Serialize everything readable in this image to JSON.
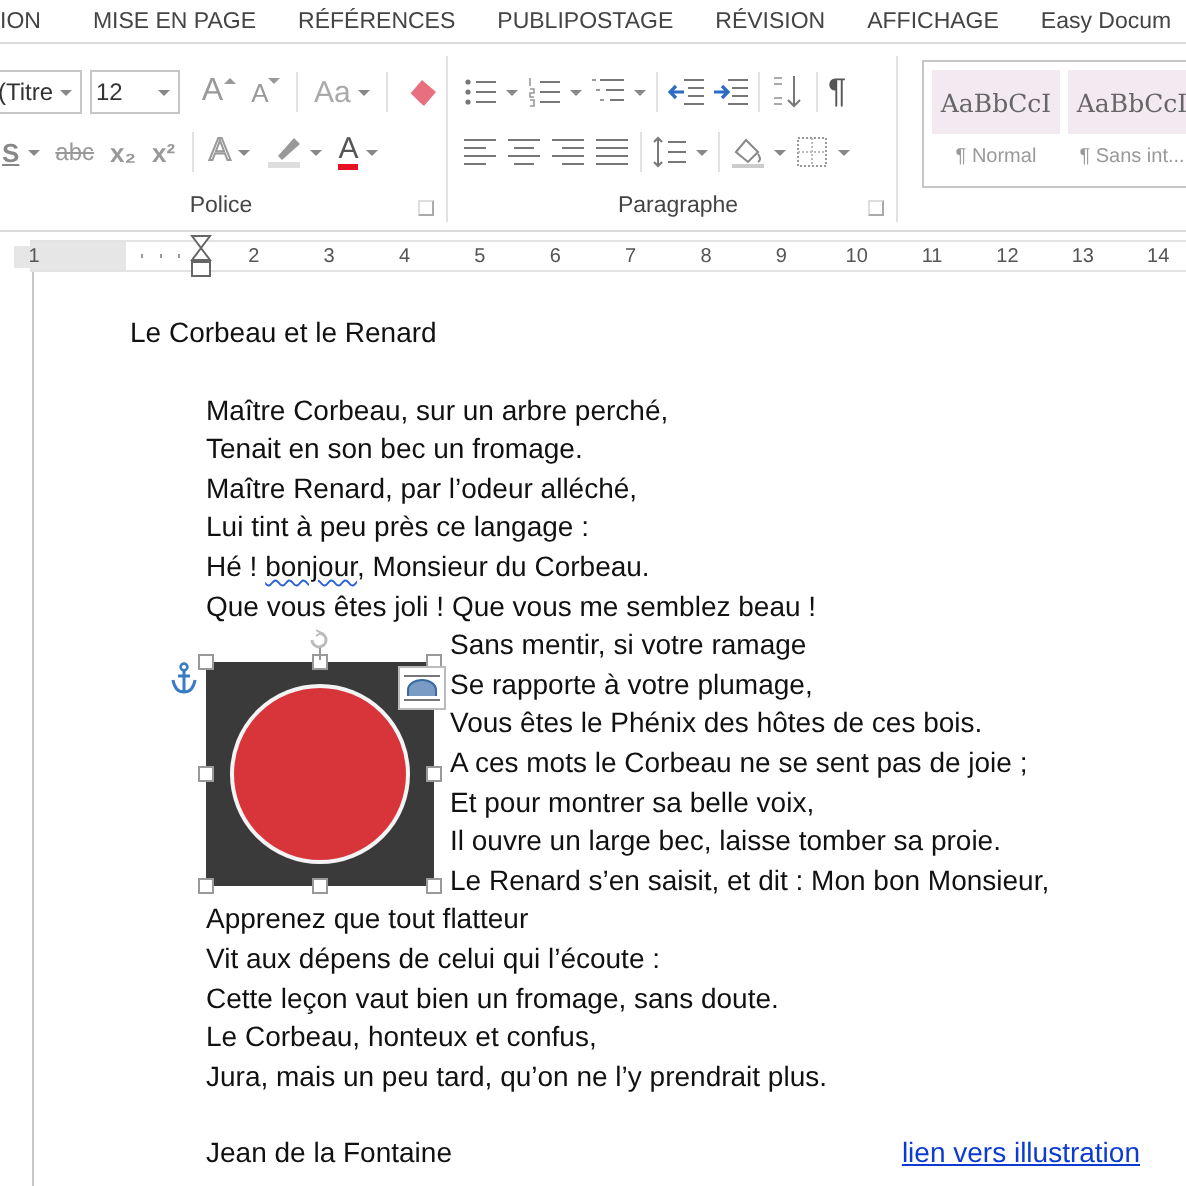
{
  "tabs": [
    {
      "label": "ION"
    },
    {
      "label": "MISE EN PAGE"
    },
    {
      "label": "RÉFÉRENCES"
    },
    {
      "label": "PUBLIPOSTAGE"
    },
    {
      "label": "RÉVISION"
    },
    {
      "label": "AFFICHAGE"
    },
    {
      "label": "Easy Docum"
    }
  ],
  "font_group": {
    "font_name": "(Titre",
    "font_size": "12",
    "label": "Police",
    "row1": [
      {
        "kind": "grow",
        "label": "A"
      },
      {
        "kind": "shrink",
        "label": "A"
      },
      {
        "kind": "sep"
      },
      {
        "kind": "case",
        "label": "Aa",
        "dropdown": true
      },
      {
        "kind": "sep"
      },
      {
        "kind": "eraser"
      }
    ],
    "row2": [
      {
        "kind": "underline",
        "label": "S",
        "dropdown": true
      },
      {
        "kind": "strike",
        "label": "abc"
      },
      {
        "kind": "subscript",
        "label": "x₂"
      },
      {
        "kind": "superscript",
        "label": "x²"
      },
      {
        "kind": "sep"
      },
      {
        "kind": "effects",
        "label": "A",
        "dropdown": true
      },
      {
        "kind": "highlight",
        "dropdown": true
      },
      {
        "kind": "fontcolor",
        "label": "A",
        "dropdown": true
      }
    ]
  },
  "paragraph_group": {
    "label": "Paragraphe",
    "row1": [
      {
        "kind": "bullets",
        "dropdown": true
      },
      {
        "kind": "numbering",
        "dropdown": true
      },
      {
        "kind": "multilevel",
        "dropdown": true
      },
      {
        "kind": "sep"
      },
      {
        "kind": "outdent"
      },
      {
        "kind": "indent"
      },
      {
        "kind": "sep"
      },
      {
        "kind": "sort"
      },
      {
        "kind": "sep"
      },
      {
        "kind": "pilcrow",
        "label": "¶"
      }
    ],
    "row2": [
      {
        "kind": "align-left"
      },
      {
        "kind": "align-center"
      },
      {
        "kind": "align-right"
      },
      {
        "kind": "justify"
      },
      {
        "kind": "sep"
      },
      {
        "kind": "spacing",
        "dropdown": true
      },
      {
        "kind": "sep"
      },
      {
        "kind": "shading",
        "dropdown": true
      },
      {
        "kind": "borders",
        "dropdown": true
      }
    ]
  },
  "styles": [
    {
      "preview": "AaBbCcI",
      "name": "¶ Normal"
    },
    {
      "preview": "AaBbCcI",
      "name": "¶ Sans int..."
    }
  ],
  "ruler": {
    "left_numbers": [
      "1"
    ],
    "right_numbers": [
      "2",
      "3",
      "4",
      "5",
      "6",
      "7",
      "8",
      "9",
      "10",
      "11",
      "12",
      "13",
      "14"
    ]
  },
  "document": {
    "title": "Le Corbeau et le Renard",
    "lines_before": [
      [
        {
          "text": "Maître Corbeau, sur un arbre perché,"
        }
      ],
      [
        {
          "text": "Tenait en son bec un fromage."
        }
      ],
      [
        {
          "text": "Maître Renard, par l’odeur alléché,"
        }
      ],
      [
        {
          "text": "Lui tint à peu près ce langage :"
        }
      ],
      [
        {
          "text": "Hé ! "
        },
        {
          "text": "bonjour",
          "misspelled": true
        },
        {
          "text": ", Monsieur du Corbeau."
        }
      ],
      [
        {
          "text": "Que vous êtes joli !  Que vous me semblez beau !"
        }
      ]
    ],
    "lines_beside_image": [
      "Sans mentir, si votre ramage",
      "Se rapporte à votre plumage,",
      "Vous êtes le Phénix des hôtes de ces bois.",
      "A ces mots le Corbeau ne se sent pas de joie ;",
      "Et pour montrer sa belle voix,",
      "Il ouvre un large bec, laisse tomber sa proie.",
      "Le Renard s’en saisit, et dit : Mon bon Monsieur,"
    ],
    "lines_after": [
      "Apprenez que tout flatteur",
      "Vit aux dépens de celui qui l’écoute :",
      "Cette leçon vaut bien un fromage, sans doute.",
      "Le Corbeau, honteux et confus,",
      "Jura, mais un peu tard, qu’on ne l’y prendrait plus."
    ],
    "image_selected": true,
    "author": "Jean de la Fontaine",
    "link": "lien vers illustration"
  }
}
